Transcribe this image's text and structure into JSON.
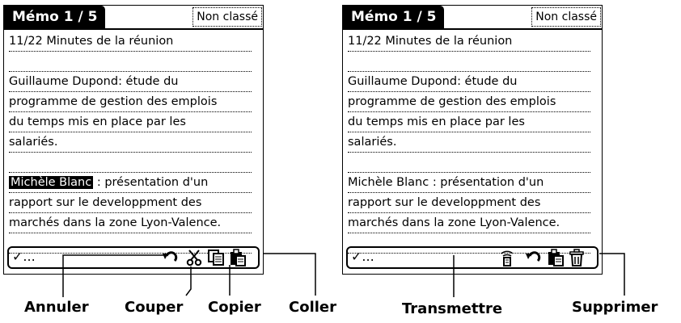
{
  "left_screen": {
    "title": "Mémo 1 / 5",
    "category": "Non classé",
    "lines": [
      "11/22 Minutes de la réunion",
      "",
      "Guillaume Dupond: étude du",
      "programme de gestion des emplois",
      "du temps mis en place par les",
      "salariés.",
      "",
      "",
      "rapport sur le developpment des",
      "marchés dans la zone Lyon-Valence.",
      ""
    ],
    "highlight_line": {
      "selected": "Michèle Blanc",
      "rest": " : présentation d'un"
    },
    "done_label": "✓..."
  },
  "right_screen": {
    "title": "Mémo 1 / 5",
    "category": "Non classé",
    "lines": [
      "11/22 Minutes de la réunion",
      "",
      "Guillaume Dupond: étude du",
      "programme de gestion des emplois",
      "du temps mis en place par les",
      "salariés.",
      "",
      "Michèle Blanc : présentation d'un",
      "rapport sur le developpment des",
      "marchés dans la zone Lyon-Valence.",
      ""
    ],
    "done_label": "✓..."
  },
  "callouts": {
    "annuler": "Annuler",
    "couper": "Couper",
    "copier": "Copier",
    "coller": "Coller",
    "transmettre": "Transmettre",
    "supprimer": "Supprimer"
  },
  "icons": [
    "undo-icon",
    "scissors-icon",
    "copy-icon",
    "paste-icon",
    "beam-icon",
    "trash-icon"
  ]
}
